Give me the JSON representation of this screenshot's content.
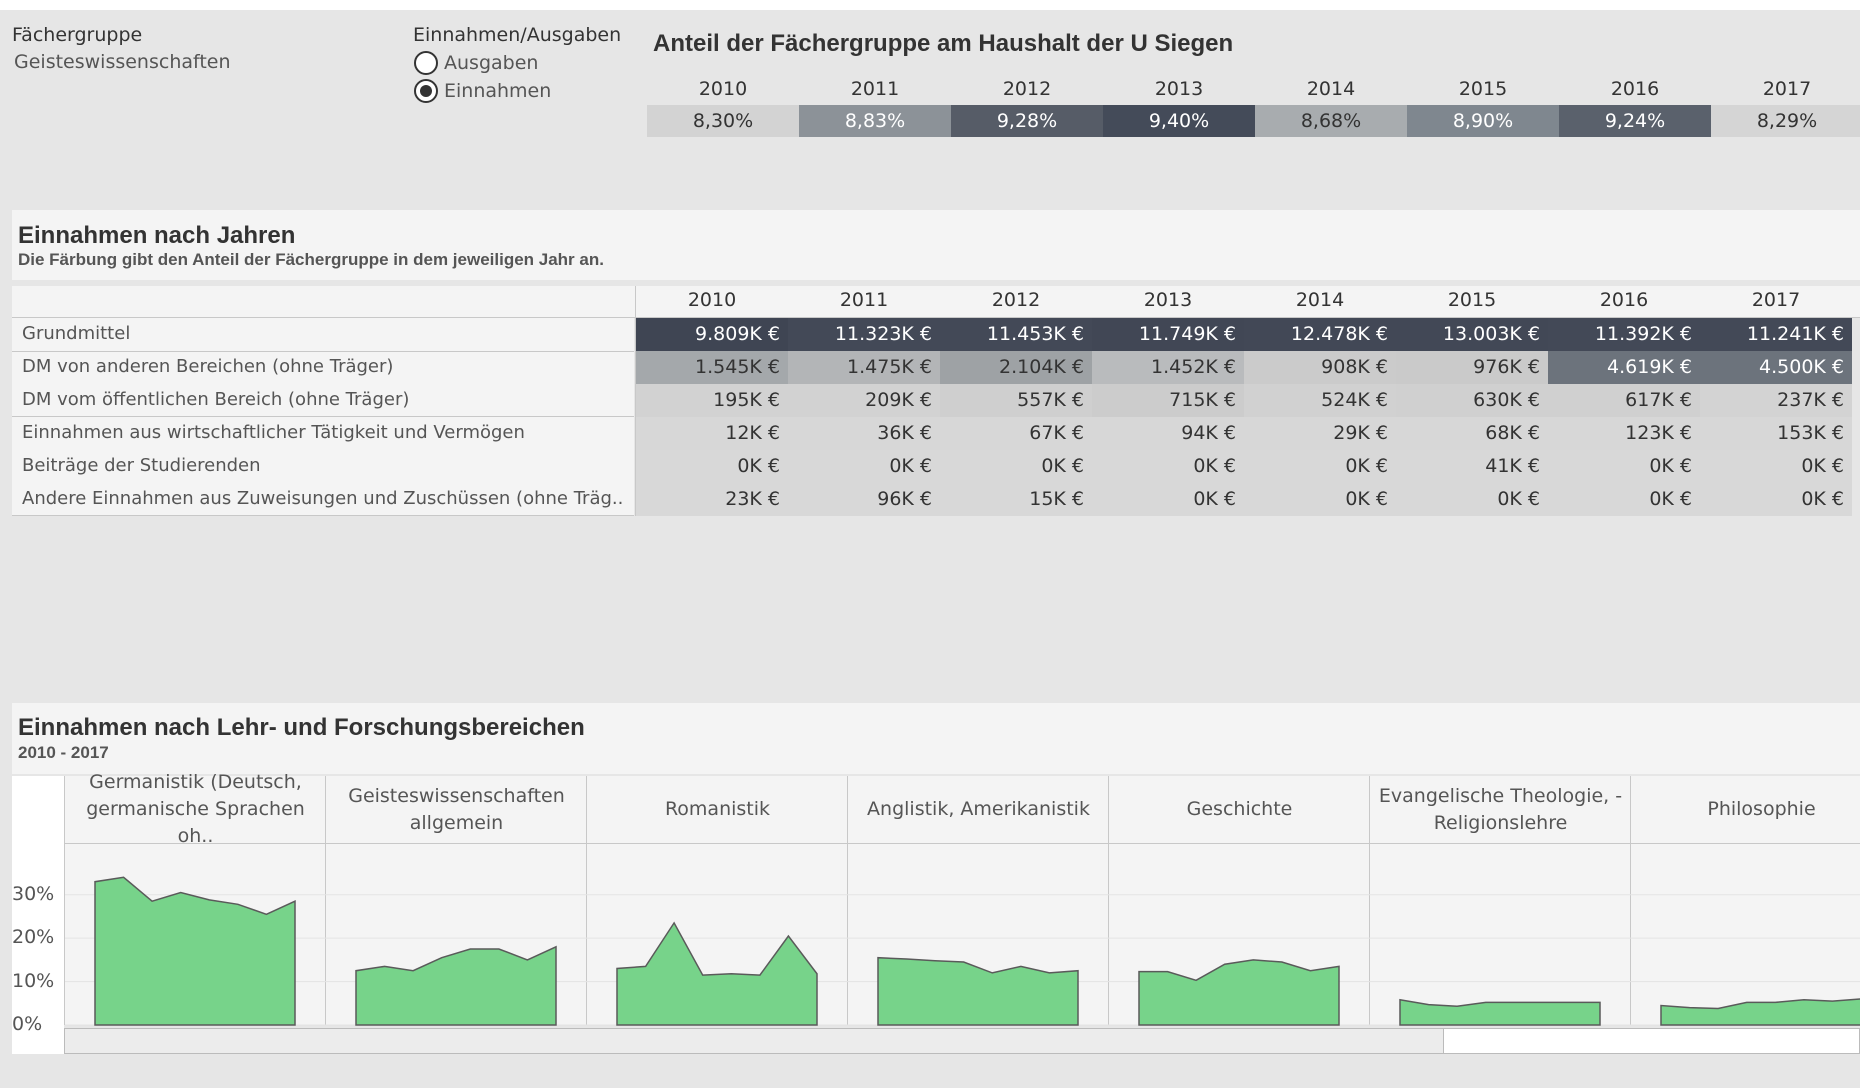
{
  "filter": {
    "label": "Fächergruppe",
    "value": "Geisteswissenschaften"
  },
  "toggle": {
    "label": "Einnahmen/Ausgaben",
    "options": [
      {
        "label": "Ausgaben",
        "selected": false
      },
      {
        "label": "Einnahmen",
        "selected": true
      }
    ]
  },
  "share": {
    "title": "Anteil der Fächergruppe am Haushalt der U Siegen",
    "years": [
      "2010",
      "2011",
      "2012",
      "2013",
      "2014",
      "2015",
      "2016",
      "2017"
    ],
    "values": [
      "8,30%",
      "8,83%",
      "9,28%",
      "9,40%",
      "8,68%",
      "8,90%",
      "9,24%",
      "8,29%"
    ],
    "colors": [
      "#d3d3d3",
      "#8c9298",
      "#565c67",
      "#444b59",
      "#a8acaf",
      "#7f878f",
      "#5a616c",
      "#d5d5d5"
    ],
    "text_colors": [
      "#333333",
      "#ffffff",
      "#ffffff",
      "#ffffff",
      "#333333",
      "#ffffff",
      "#ffffff",
      "#333333"
    ]
  },
  "income_table": {
    "title": "Einnahmen nach Jahren",
    "subtitle": "Die Färbung gibt den Anteil der Fächergruppe in dem jeweiligen Jahr an.",
    "years": [
      "2010",
      "2011",
      "2012",
      "2013",
      "2014",
      "2015",
      "2016",
      "2017"
    ],
    "rows": [
      {
        "label": "Grundmittel",
        "values": [
          "9.809K €",
          "11.323K €",
          "11.453K €",
          "11.749K €",
          "12.478K €",
          "13.003K €",
          "11.392K €",
          "11.241K €"
        ],
        "colors": [
          "#3f4553",
          "#434957",
          "#434957",
          "#414755",
          "#424856",
          "#424856",
          "#434957",
          "#434957"
        ],
        "text_colors": [
          "#ffffff",
          "#ffffff",
          "#ffffff",
          "#ffffff",
          "#ffffff",
          "#ffffff",
          "#ffffff",
          "#ffffff"
        ]
      },
      {
        "label": "DM von anderen Bereichen (ohne Träger)",
        "values": [
          "1.545K €",
          "1.475K €",
          "2.104K €",
          "1.452K €",
          "908K €",
          "976K €",
          "4.619K €",
          "4.500K €"
        ],
        "colors": [
          "#a4a8ab",
          "#b3b5b7",
          "#9ea2a5",
          "#b9bbbd",
          "#cbcbcb",
          "#cacaca",
          "#6c737c",
          "#6c737c"
        ],
        "text_colors": [
          "#333333",
          "#333333",
          "#333333",
          "#333333",
          "#333333",
          "#333333",
          "#ffffff",
          "#ffffff"
        ]
      },
      {
        "label": "DM vom öffentlichen Bereich (ohne Träger)",
        "values": [
          "195K €",
          "209K €",
          "557K €",
          "715K €",
          "524K €",
          "630K €",
          "617K €",
          "237K €"
        ],
        "colors": [
          "#d2d2d2",
          "#d2d2d2",
          "#cfcfcf",
          "#cccccc",
          "#d1d1d1",
          "#d0d0d0",
          "#d0d0d0",
          "#d3d3d3"
        ],
        "text_colors": [
          "#333333",
          "#333333",
          "#333333",
          "#333333",
          "#333333",
          "#333333",
          "#333333",
          "#333333"
        ]
      },
      {
        "label": "Einnahmen aus wirtschaftlicher Tätigkeit und Vermögen",
        "values": [
          "12K €",
          "36K €",
          "67K €",
          "94K €",
          "29K €",
          "68K €",
          "123K €",
          "153K €"
        ],
        "colors": [
          "#d7d7d7",
          "#d7d7d7",
          "#d7d7d7",
          "#d7d7d7",
          "#d7d7d7",
          "#d7d7d7",
          "#d7d7d7",
          "#d7d7d7"
        ],
        "text_colors": [
          "#333333",
          "#333333",
          "#333333",
          "#333333",
          "#333333",
          "#333333",
          "#333333",
          "#333333"
        ]
      },
      {
        "label": "Beiträge der Studierenden",
        "values": [
          "0K €",
          "0K €",
          "0K €",
          "0K €",
          "0K €",
          "41K €",
          "0K €",
          "0K €"
        ],
        "colors": [
          "#d8d8d8",
          "#d8d8d8",
          "#d8d8d8",
          "#d8d8d8",
          "#d8d8d8",
          "#d8d8d8",
          "#d8d8d8",
          "#d8d8d8"
        ],
        "text_colors": [
          "#333333",
          "#333333",
          "#333333",
          "#333333",
          "#333333",
          "#333333",
          "#333333",
          "#333333"
        ]
      },
      {
        "label": "Andere Einnahmen aus Zuweisungen und Zuschüssen (ohne Träg..",
        "values": [
          "23K €",
          "96K €",
          "15K €",
          "0K €",
          "0K €",
          "0K €",
          "0K €",
          "0K €"
        ],
        "colors": [
          "#d8d8d8",
          "#d8d8d8",
          "#d8d8d8",
          "#d8d8d8",
          "#d8d8d8",
          "#d8d8d8",
          "#d8d8d8",
          "#d8d8d8"
        ],
        "text_colors": [
          "#333333",
          "#333333",
          "#333333",
          "#333333",
          "#333333",
          "#333333",
          "#333333",
          "#333333"
        ]
      }
    ]
  },
  "area_section": {
    "title": "Einnahmen nach Lehr- und Forschungsbereichen",
    "subtitle": "2010 - 2017"
  },
  "chart_data": {
    "type": "area",
    "x": [
      "2010",
      "2011",
      "2012",
      "2013",
      "2014",
      "2015",
      "2016",
      "2017"
    ],
    "y_ticks": [
      "30%",
      "20%",
      "10%",
      "0%"
    ],
    "ylim": [
      0,
      35
    ],
    "fill_color": "#77d38a",
    "stroke_color": "#5a5a5a",
    "panels": [
      {
        "label": "Germanistik (Deutsch, germanische Sprachen oh..",
        "values": [
          33,
          34,
          28.5,
          30.5,
          28.8,
          27.8,
          25.5,
          28.5
        ]
      },
      {
        "label": "Geisteswissenschaften allgemein",
        "values": [
          12.5,
          13.5,
          12.5,
          15.5,
          17.5,
          17.5,
          15,
          18
        ]
      },
      {
        "label": "Romanistik",
        "values": [
          13,
          13.5,
          23.5,
          11.5,
          11.8,
          11.5,
          20.5,
          11.8
        ]
      },
      {
        "label": "Anglistik, Amerikanistik",
        "values": [
          15.5,
          15.2,
          14.8,
          14.5,
          12,
          13.5,
          12,
          12.5
        ]
      },
      {
        "label": "Geschichte",
        "values": [
          12.3,
          12.3,
          10.3,
          14,
          15,
          14.5,
          12.5,
          13.5
        ]
      },
      {
        "label": "Evangelische Theologie, -Religionslehre",
        "values": [
          5.8,
          4.7,
          4.3,
          5.2,
          5.2,
          5.2,
          5.2,
          5.2
        ]
      },
      {
        "label": "Philosophie",
        "values": [
          4.5,
          4,
          3.8,
          5.2,
          5.2,
          5.8,
          5.5,
          6
        ]
      }
    ]
  }
}
